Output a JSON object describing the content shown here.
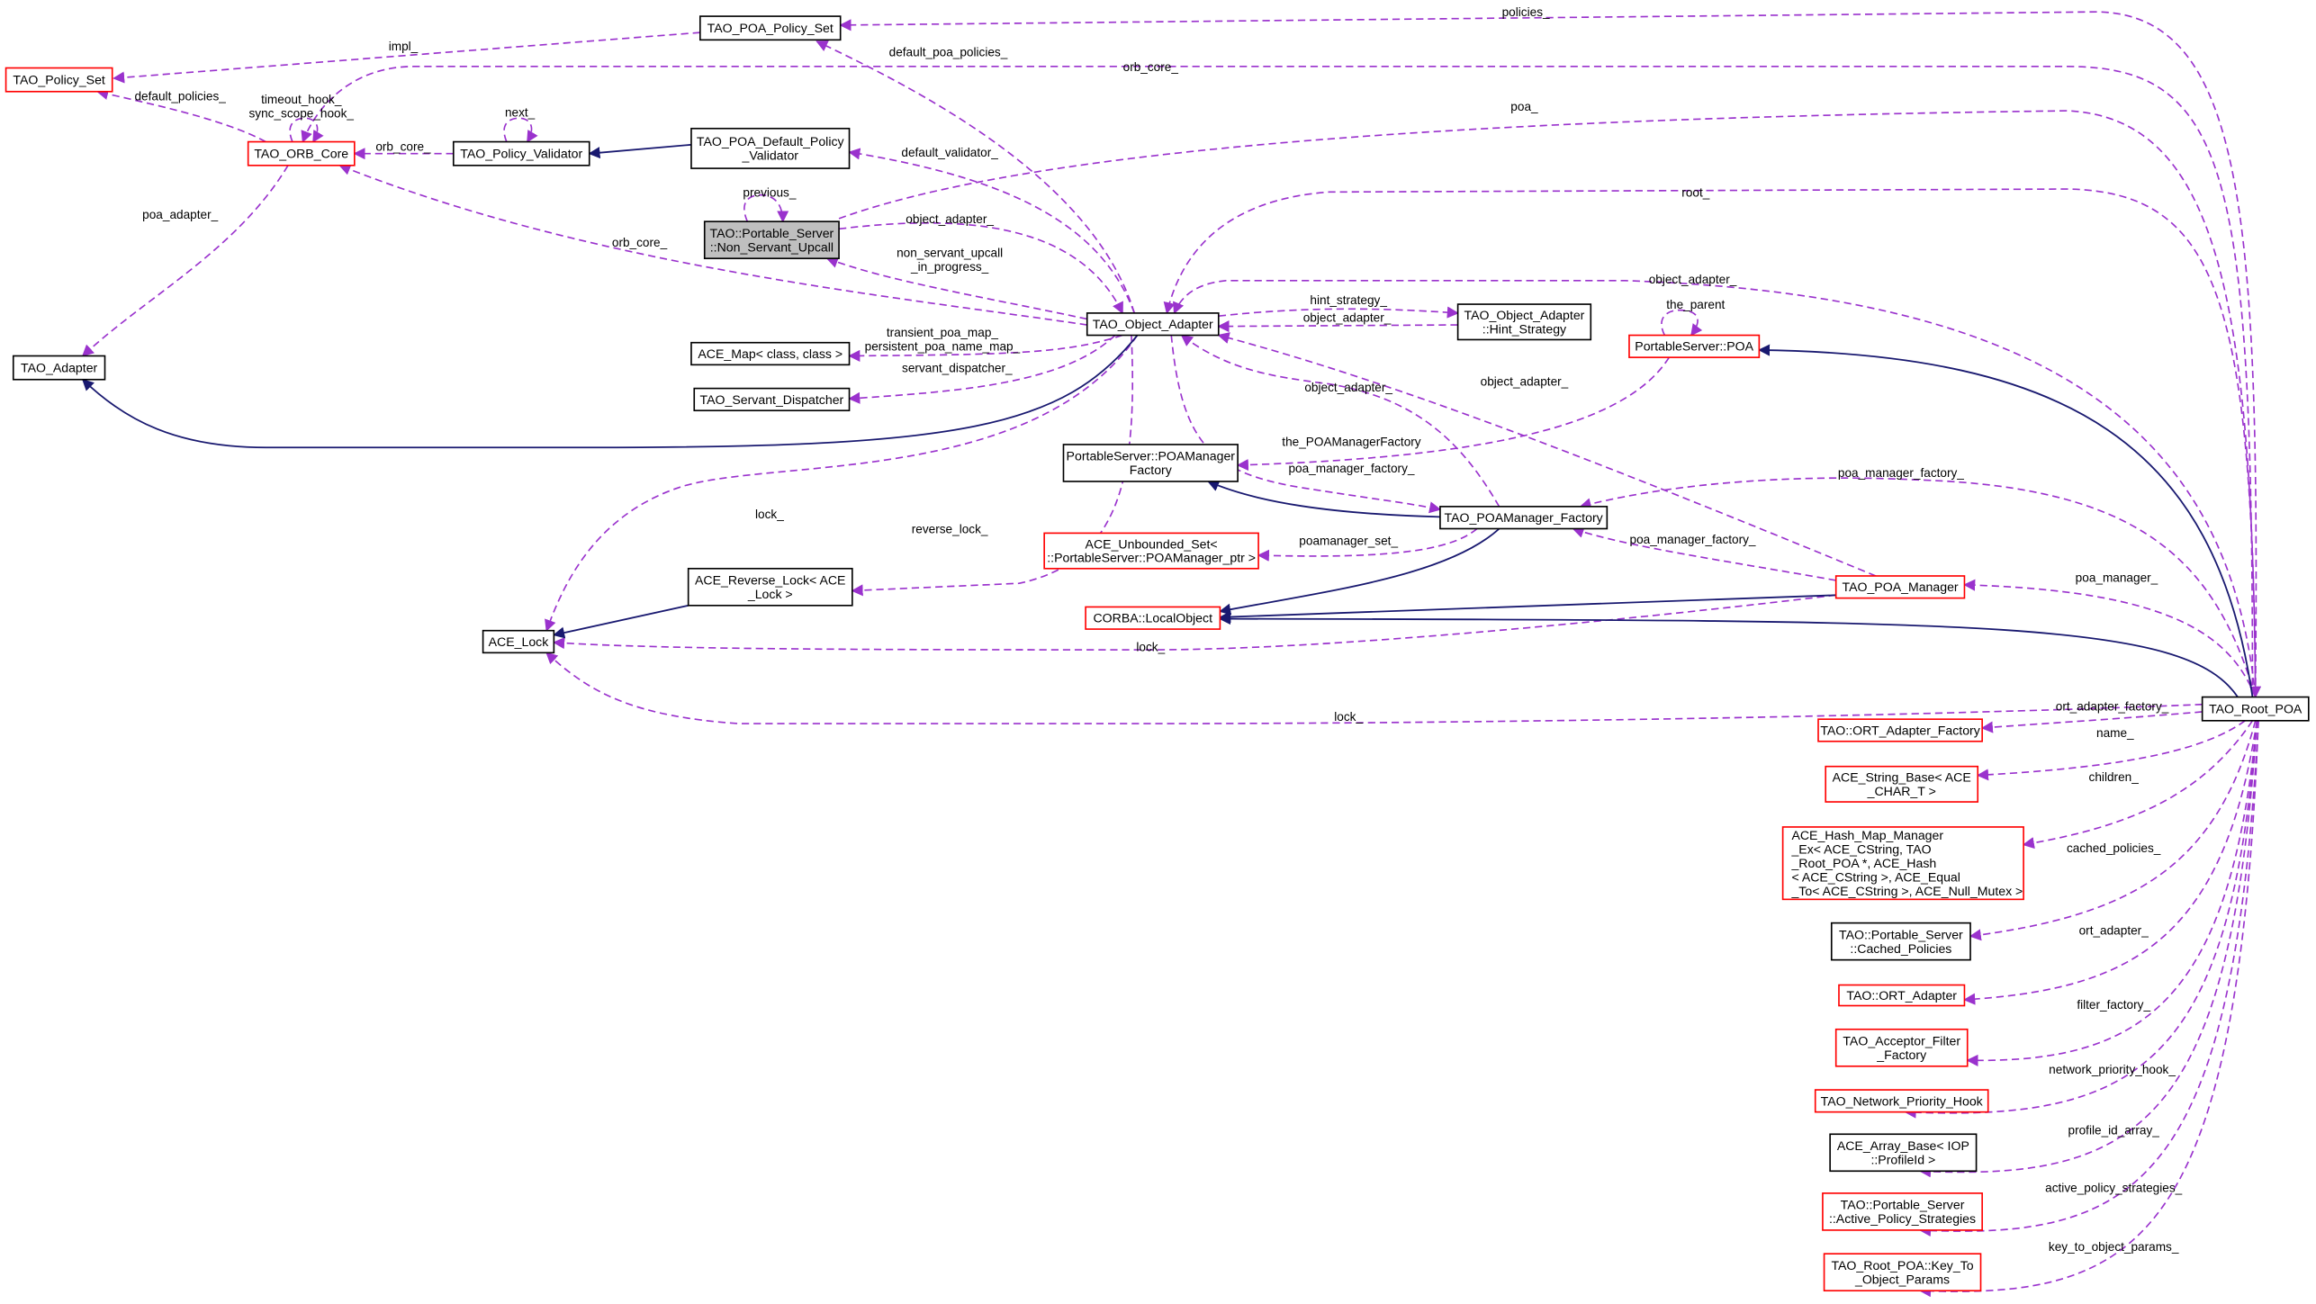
{
  "colors": {
    "usage_edge": "#9a32cd",
    "inheritance_edge": "#191970",
    "incomplete_border": "#ff0000",
    "normal_border": "#000000",
    "highlight_fill": "#bfbfbf"
  },
  "nodes": {
    "poa_policy_set": {
      "lines": [
        "TAO_POA_Policy_Set"
      ],
      "border": "black"
    },
    "policy_set": {
      "lines": [
        "TAO_Policy_Set"
      ],
      "border": "red"
    },
    "orb_core": {
      "lines": [
        "TAO_ORB_Core"
      ],
      "border": "red"
    },
    "policy_validator": {
      "lines": [
        "TAO_Policy_Validator"
      ],
      "border": "black"
    },
    "default_policy_validator": {
      "lines": [
        "TAO_POA_Default_Policy",
        "_Validator"
      ],
      "border": "black"
    },
    "non_servant_upcall": {
      "lines": [
        "TAO::Portable_Server",
        "::Non_Servant_Upcall"
      ],
      "border": "black",
      "highlighted": true
    },
    "object_adapter": {
      "lines": [
        "TAO_Object_Adapter"
      ],
      "border": "black"
    },
    "adapter": {
      "lines": [
        "TAO_Adapter"
      ],
      "border": "black"
    },
    "ace_map": {
      "lines": [
        "ACE_Map< class, class >"
      ],
      "border": "black"
    },
    "servant_dispatcher": {
      "lines": [
        "TAO_Servant_Dispatcher"
      ],
      "border": "black"
    },
    "hint_strategy": {
      "lines": [
        "TAO_Object_Adapter",
        "::Hint_Strategy"
      ],
      "border": "black"
    },
    "portableserver_poa": {
      "lines": [
        "PortableServer::POA"
      ],
      "border": "red"
    },
    "poamanager_factory_iface": {
      "lines": [
        "PortableServer::POAManager",
        "Factory"
      ],
      "border": "black"
    },
    "tao_poamanager_factory": {
      "lines": [
        "TAO_POAManager_Factory"
      ],
      "border": "black"
    },
    "unbounded_set": {
      "lines": [
        "ACE_Unbounded_Set<",
        "::PortableServer::POAManager_ptr >"
      ],
      "border": "red"
    },
    "reverse_lock": {
      "lines": [
        "ACE_Reverse_Lock< ACE",
        "_Lock >"
      ],
      "border": "black"
    },
    "local_object": {
      "lines": [
        "CORBA::LocalObject"
      ],
      "border": "red"
    },
    "poa_manager": {
      "lines": [
        "TAO_POA_Manager"
      ],
      "border": "red"
    },
    "ace_lock": {
      "lines": [
        "ACE_Lock"
      ],
      "border": "black"
    },
    "root_poa": {
      "lines": [
        "TAO_Root_POA"
      ],
      "border": "black"
    },
    "ort_adapter_factory": {
      "lines": [
        "TAO::ORT_Adapter_Factory"
      ],
      "border": "red"
    },
    "string_base": {
      "lines": [
        "ACE_String_Base< ACE",
        "_CHAR_T >"
      ],
      "border": "red"
    },
    "hash_map": {
      "lines": [
        "ACE_Hash_Map_Manager",
        "_Ex< ACE_CString, TAO",
        "_Root_POA *, ACE_Hash",
        "< ACE_CString >, ACE_Equal",
        "_To< ACE_CString >, ACE_Null_Mutex >"
      ],
      "border": "red"
    },
    "cached_policies": {
      "lines": [
        "TAO::Portable_Server",
        "::Cached_Policies"
      ],
      "border": "black"
    },
    "ort_adapter": {
      "lines": [
        "TAO::ORT_Adapter"
      ],
      "border": "red"
    },
    "acceptor_filter": {
      "lines": [
        "TAO_Acceptor_Filter",
        "_Factory"
      ],
      "border": "red"
    },
    "network_priority_hook": {
      "lines": [
        "TAO_Network_Priority_Hook"
      ],
      "border": "red"
    },
    "array_base": {
      "lines": [
        "ACE_Array_Base< IOP",
        "::ProfileId >"
      ],
      "border": "black"
    },
    "active_policy": {
      "lines": [
        "TAO::Portable_Server",
        "::Active_Policy_Strategies"
      ],
      "border": "red"
    },
    "key_to_object": {
      "lines": [
        "TAO_Root_POA::Key_To",
        "_Object_Params"
      ],
      "border": "red"
    }
  },
  "edges": [
    {
      "from": "root_poa",
      "to": "poa_policy_set",
      "kind": "usage",
      "label": [
        "policies_"
      ]
    },
    {
      "from": "poa_policy_set",
      "to": "policy_set",
      "kind": "usage",
      "label": [
        "impl_"
      ]
    },
    {
      "from": "root_poa",
      "to": "orb_core",
      "kind": "usage",
      "label": [
        "orb_core_"
      ]
    },
    {
      "from": "orb_core",
      "to": "policy_set",
      "kind": "usage",
      "label": [
        "default_policies_"
      ]
    },
    {
      "from": "orb_core",
      "to": "orb_core",
      "kind": "usage",
      "label": [
        "timeout_hook_",
        "sync_scope_hook_"
      ]
    },
    {
      "from": "policy_validator",
      "to": "orb_core",
      "kind": "usage",
      "label": [
        "orb_core_"
      ]
    },
    {
      "from": "policy_validator",
      "to": "policy_validator",
      "kind": "usage",
      "label": [
        "next_"
      ]
    },
    {
      "from": "object_adapter",
      "to": "poa_policy_set",
      "kind": "usage",
      "label": [
        "default_poa_policies_"
      ]
    },
    {
      "from": "object_adapter",
      "to": "default_policy_validator",
      "kind": "usage",
      "label": [
        "default_validator_"
      ]
    },
    {
      "from": "non_servant_upcall",
      "to": "root_poa",
      "kind": "usage",
      "label": [
        "poa_"
      ]
    },
    {
      "from": "non_servant_upcall",
      "to": "non_servant_upcall",
      "kind": "usage",
      "label": [
        "previous_"
      ]
    },
    {
      "from": "non_servant_upcall",
      "to": "object_adapter",
      "kind": "usage",
      "label": [
        "object_adapter_"
      ]
    },
    {
      "from": "object_adapter",
      "to": "non_servant_upcall",
      "kind": "usage",
      "label": [
        "non_servant_upcall",
        "_in_progress_"
      ]
    },
    {
      "from": "object_adapter",
      "to": "orb_core",
      "kind": "usage",
      "label": [
        "orb_core_"
      ]
    },
    {
      "from": "orb_core",
      "to": "adapter",
      "kind": "usage",
      "label": [
        "poa_adapter_"
      ]
    },
    {
      "from": "root_poa",
      "to": "object_adapter",
      "kind": "usage",
      "label": [
        "root_"
      ]
    },
    {
      "from": "root_poa",
      "to": "object_adapter",
      "kind": "usage",
      "label": [
        "object_adapter_"
      ]
    },
    {
      "from": "object_adapter",
      "to": "hint_strategy",
      "kind": "usage",
      "label": [
        "hint_strategy_"
      ]
    },
    {
      "from": "hint_strategy",
      "to": "object_adapter",
      "kind": "usage",
      "label": [
        "object_adapter_"
      ]
    },
    {
      "from": "object_adapter",
      "to": "ace_map",
      "kind": "usage",
      "label": [
        "transient_poa_map_",
        "persistent_poa_name_map_"
      ]
    },
    {
      "from": "object_adapter",
      "to": "servant_dispatcher",
      "kind": "usage",
      "label": [
        "servant_dispatcher_"
      ]
    },
    {
      "from": "tao_poamanager_factory",
      "to": "object_adapter",
      "kind": "usage",
      "label": [
        "object_adapter_"
      ]
    },
    {
      "from": "poa_manager",
      "to": "object_adapter",
      "kind": "usage",
      "label": [
        "object_adapter_"
      ]
    },
    {
      "from": "portableserver_poa",
      "to": "portableserver_poa",
      "kind": "usage",
      "label": [
        "the_parent"
      ]
    },
    {
      "from": "portableserver_poa",
      "to": "poamanager_factory_iface",
      "kind": "usage",
      "label": [
        "the_POAManagerFactory"
      ]
    },
    {
      "from": "object_adapter",
      "to": "tao_poamanager_factory",
      "kind": "usage",
      "label": [
        "poa_manager_factory_"
      ]
    },
    {
      "from": "root_poa",
      "to": "tao_poamanager_factory",
      "kind": "usage",
      "label": [
        "poa_manager_factory_"
      ]
    },
    {
      "from": "poa_manager",
      "to": "tao_poamanager_factory",
      "kind": "usage",
      "label": [
        "poa_manager_factory_"
      ]
    },
    {
      "from": "tao_poamanager_factory",
      "to": "unbounded_set",
      "kind": "usage",
      "label": [
        "poamanager_set_"
      ]
    },
    {
      "from": "object_adapter",
      "to": "ace_lock",
      "kind": "usage",
      "label": [
        "lock_"
      ]
    },
    {
      "from": "object_adapter",
      "to": "reverse_lock",
      "kind": "usage",
      "label": [
        "reverse_lock_"
      ]
    },
    {
      "from": "poa_manager",
      "to": "ace_lock",
      "kind": "usage",
      "label": [
        "lock_"
      ]
    },
    {
      "from": "root_poa",
      "to": "ace_lock",
      "kind": "usage",
      "label": [
        "lock_"
      ]
    },
    {
      "from": "root_poa",
      "to": "poa_manager",
      "kind": "usage",
      "label": [
        "poa_manager_"
      ]
    },
    {
      "from": "root_poa",
      "to": "ort_adapter_factory",
      "kind": "usage",
      "label": [
        "ort_adapter_factory_"
      ]
    },
    {
      "from": "root_poa",
      "to": "string_base",
      "kind": "usage",
      "label": [
        "name_"
      ]
    },
    {
      "from": "root_poa",
      "to": "hash_map",
      "kind": "usage",
      "label": [
        "children_"
      ]
    },
    {
      "from": "root_poa",
      "to": "cached_policies",
      "kind": "usage",
      "label": [
        "cached_policies_"
      ]
    },
    {
      "from": "root_poa",
      "to": "ort_adapter",
      "kind": "usage",
      "label": [
        "ort_adapter_"
      ]
    },
    {
      "from": "root_poa",
      "to": "acceptor_filter",
      "kind": "usage",
      "label": [
        "filter_factory_"
      ]
    },
    {
      "from": "root_poa",
      "to": "network_priority_hook",
      "kind": "usage",
      "label": [
        "network_priority_hook_"
      ]
    },
    {
      "from": "root_poa",
      "to": "array_base",
      "kind": "usage",
      "label": [
        "profile_id_array_"
      ]
    },
    {
      "from": "root_poa",
      "to": "active_policy",
      "kind": "usage",
      "label": [
        "active_policy_strategies_"
      ]
    },
    {
      "from": "root_poa",
      "to": "key_to_object",
      "kind": "usage",
      "label": [
        "key_to_object_params_"
      ]
    },
    {
      "from": "default_policy_validator",
      "to": "policy_validator",
      "kind": "inheritance",
      "label": []
    },
    {
      "from": "object_adapter",
      "to": "adapter",
      "kind": "inheritance",
      "label": []
    },
    {
      "from": "root_poa",
      "to": "portableserver_poa",
      "kind": "inheritance",
      "label": []
    },
    {
      "from": "tao_poamanager_factory",
      "to": "poamanager_factory_iface",
      "kind": "inheritance",
      "label": []
    },
    {
      "from": "tao_poamanager_factory",
      "to": "local_object",
      "kind": "inheritance",
      "label": []
    },
    {
      "from": "poa_manager",
      "to": "local_object",
      "kind": "inheritance",
      "label": []
    },
    {
      "from": "root_poa",
      "to": "local_object",
      "kind": "inheritance",
      "label": []
    },
    {
      "from": "reverse_lock",
      "to": "ace_lock",
      "kind": "inheritance",
      "label": []
    }
  ]
}
